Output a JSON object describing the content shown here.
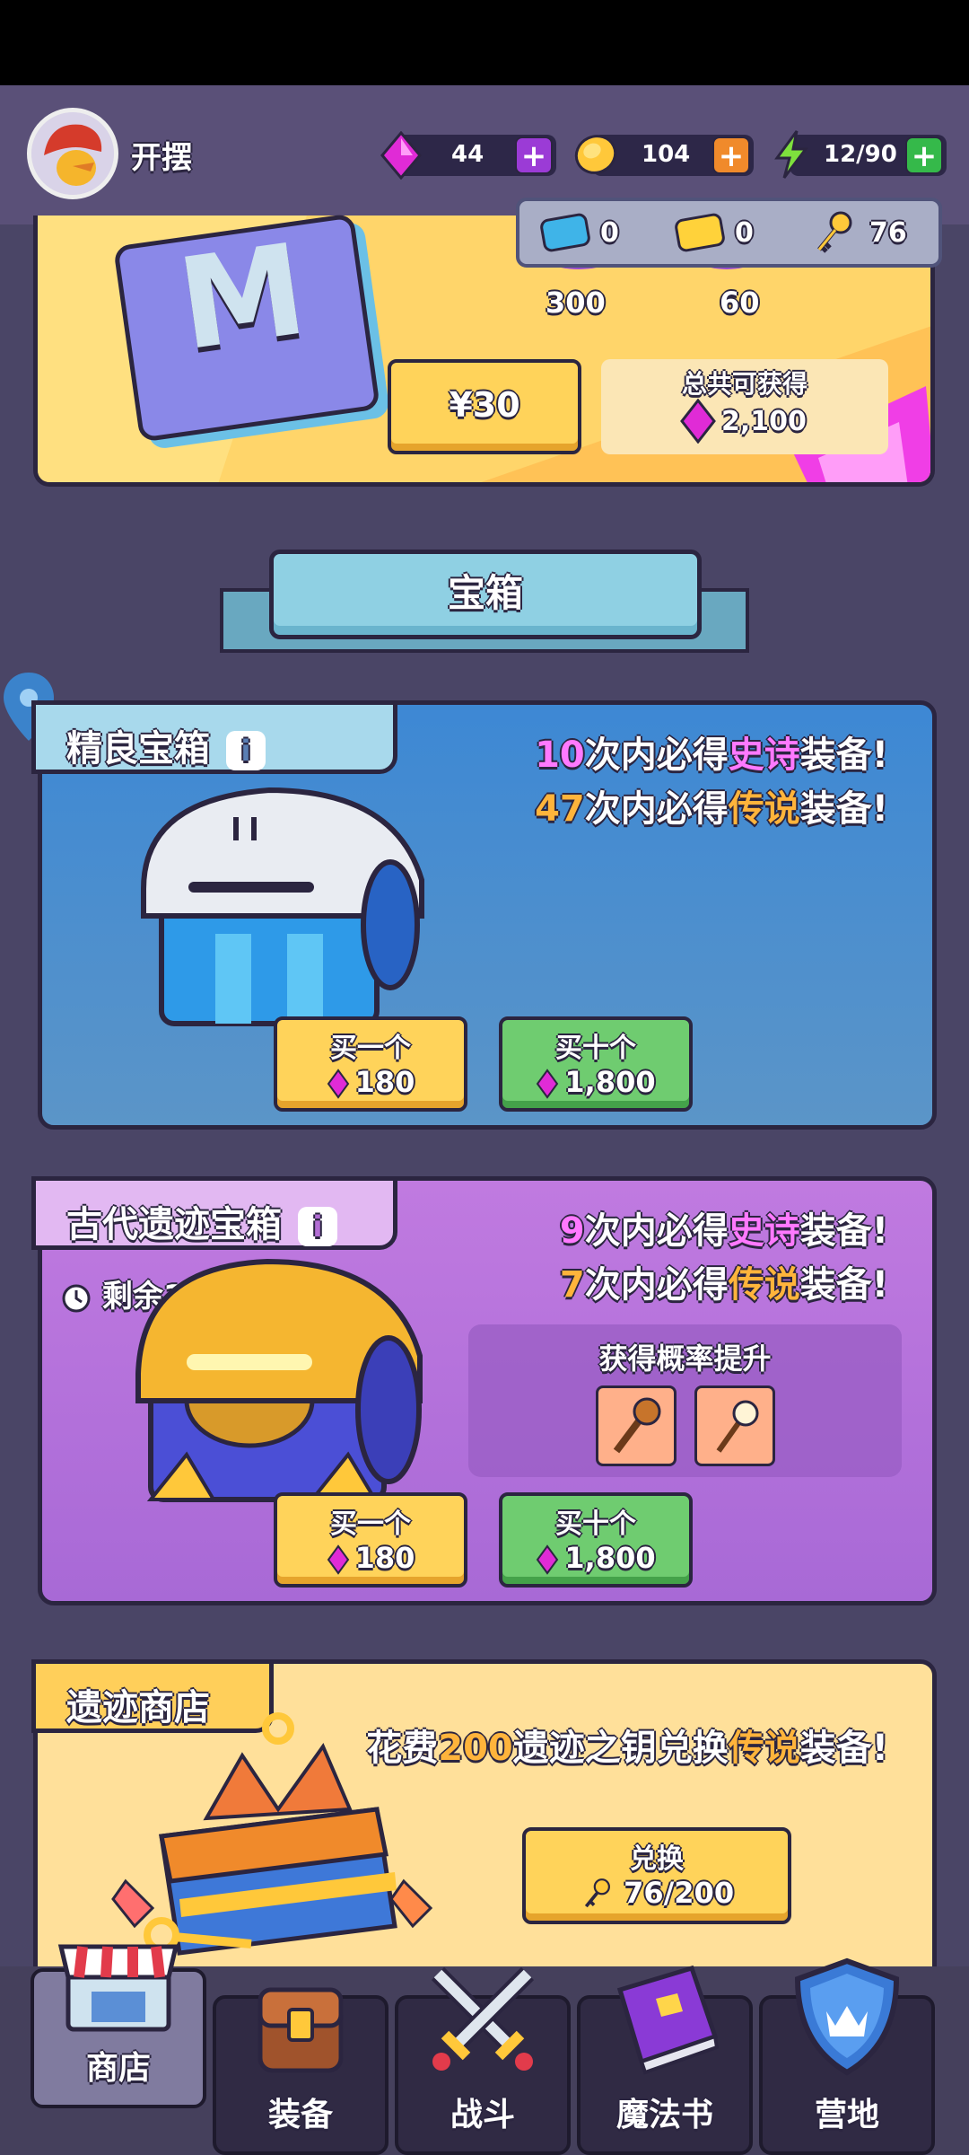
{
  "header": {
    "player_name": "开摆",
    "gems": "44",
    "coins": "104",
    "energy": "12/90",
    "blue_tickets": "0",
    "gold_tickets": "0",
    "keys": "76"
  },
  "pass_card": {
    "letter": "M",
    "reward_a": "300",
    "reward_b": "60",
    "price": "¥30",
    "total_label": "总共可获得",
    "total_value": "2,100"
  },
  "section_title": "宝箱",
  "fine_chest": {
    "title": "精良宝箱",
    "info_icon": "i",
    "epic_count": "10",
    "epic_text_a": "次内必得",
    "epic_word": "史诗",
    "epic_text_b": "装备!",
    "legend_count": "47",
    "legend_text_a": "次内必得",
    "legend_word": "传说",
    "legend_text_b": "装备!",
    "buy_one_label": "买一个",
    "buy_one_price": "180",
    "buy_ten_label": "买十个",
    "buy_ten_price": "1,800"
  },
  "ancient_chest": {
    "title": "古代遗迹宝箱",
    "info_icon": "i",
    "remaining": "剩余1天",
    "epic_count": "9",
    "epic_text_a": "次内必得",
    "epic_word": "史诗",
    "epic_text_b": "装备!",
    "legend_count": "7",
    "legend_text_a": "次内必得",
    "legend_word": "传说",
    "legend_text_b": "装备!",
    "boost_title": "获得概率提升",
    "buy_one_label": "买一个",
    "buy_one_price": "180",
    "buy_ten_label": "买十个",
    "buy_ten_price": "1,800"
  },
  "relic_shop": {
    "title": "遗迹商店",
    "text_a": "花费",
    "count": "200",
    "text_b": "遗迹之钥兑换",
    "legend_word": "传说",
    "text_c": "装备!",
    "exchange_label": "兑换",
    "exchange_progress": "76/200"
  },
  "nav": [
    {
      "label": "商店",
      "icon": "shop-icon"
    },
    {
      "label": "装备",
      "icon": "backpack-icon"
    },
    {
      "label": "战斗",
      "icon": "crossed-swords-icon"
    },
    {
      "label": "魔法书",
      "icon": "spellbook-icon"
    },
    {
      "label": "营地",
      "icon": "camp-shield-icon"
    }
  ],
  "colors": {
    "gem": "#e02bd6",
    "coin": "#ffc83a",
    "energy": "#7ee03d",
    "epic": "#ff79ff",
    "legend": "#ffb43b"
  }
}
